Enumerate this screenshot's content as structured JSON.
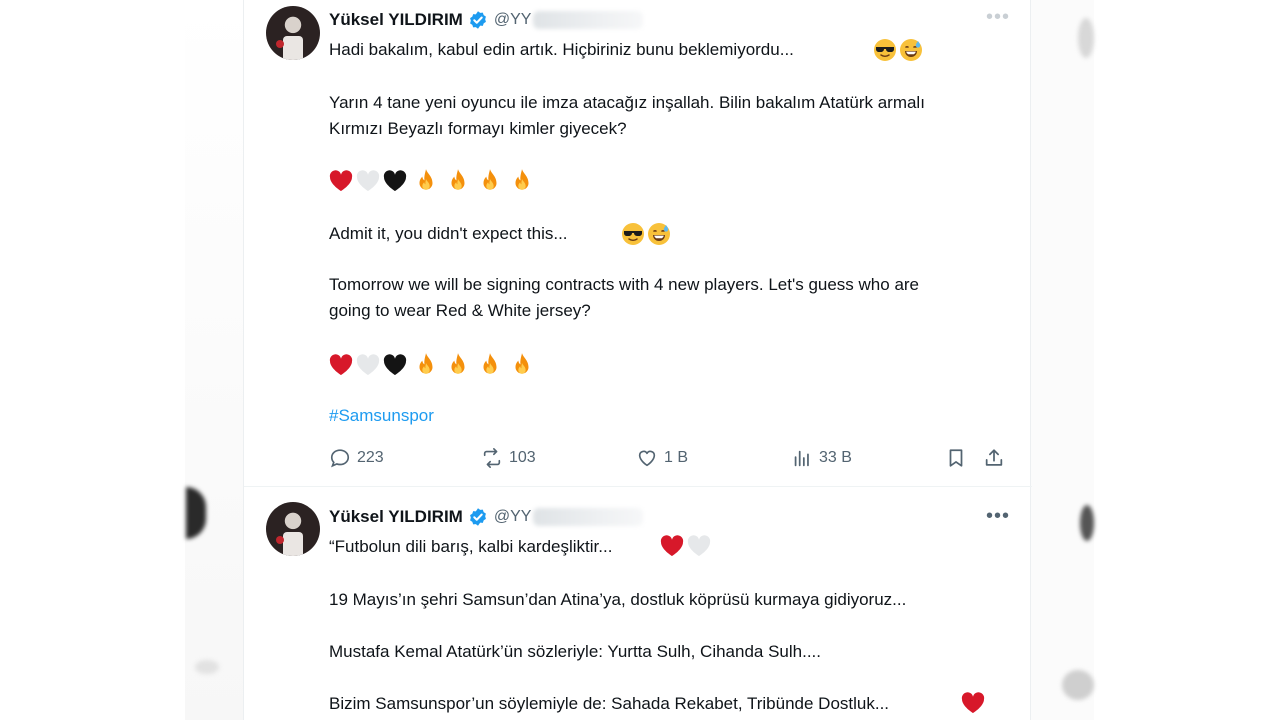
{
  "tweets": [
    {
      "author": {
        "name": "Yüksel YILDIRIM",
        "handle_prefix": "@YY"
      },
      "lines": [
        "Hadi bakalım, kabul edin artık. Hiçbiriniz bunu beklemiyordu...",
        "Yarın 4 tane yeni oyuncu ile imza atacağız inşallah. Bilin bakalım Atatürk armalı",
        "Kırmızı Beyazlı formayı kimler  giyecek?",
        "Admit it, you didn't expect this...",
        "Tomorrow we will be signing contracts with 4 new players. Let's guess who are",
        "going to wear Red & White jersey?"
      ],
      "hashtag": "#Samsunspor",
      "stats": {
        "replies": "223",
        "reposts": "103",
        "likes": "1 B",
        "views": "33 B"
      }
    },
    {
      "author": {
        "name": "Yüksel YILDIRIM",
        "handle_prefix": "@YY"
      },
      "lines": [
        "“Futbolun dili barış, kalbi kardeşliktir...",
        "19 Mayıs’ın şehri Samsun’dan Atina’ya, dostluk köprüsü kurmaya gidiyoruz...",
        "Mustafa Kemal Atatürk’ün sözleriyle: Yurtta Sulh, Cihanda Sulh....",
        "Bizim Samsunspor’un söylemiyle de: Sahada Rekabet, Tribünde Dostluk..."
      ],
      "more_label": "•••"
    }
  ],
  "icons": {
    "reply": "comment-icon",
    "repost": "retweet-icon",
    "like": "heart-icon",
    "views": "analytics-icon",
    "bookmark": "bookmark-icon",
    "share": "share-icon",
    "verified": "verified-badge-icon"
  },
  "colors": {
    "accent": "#1d9bf0",
    "text": "#0f1419",
    "muted": "#536471",
    "red_heart": "#d7182a"
  }
}
